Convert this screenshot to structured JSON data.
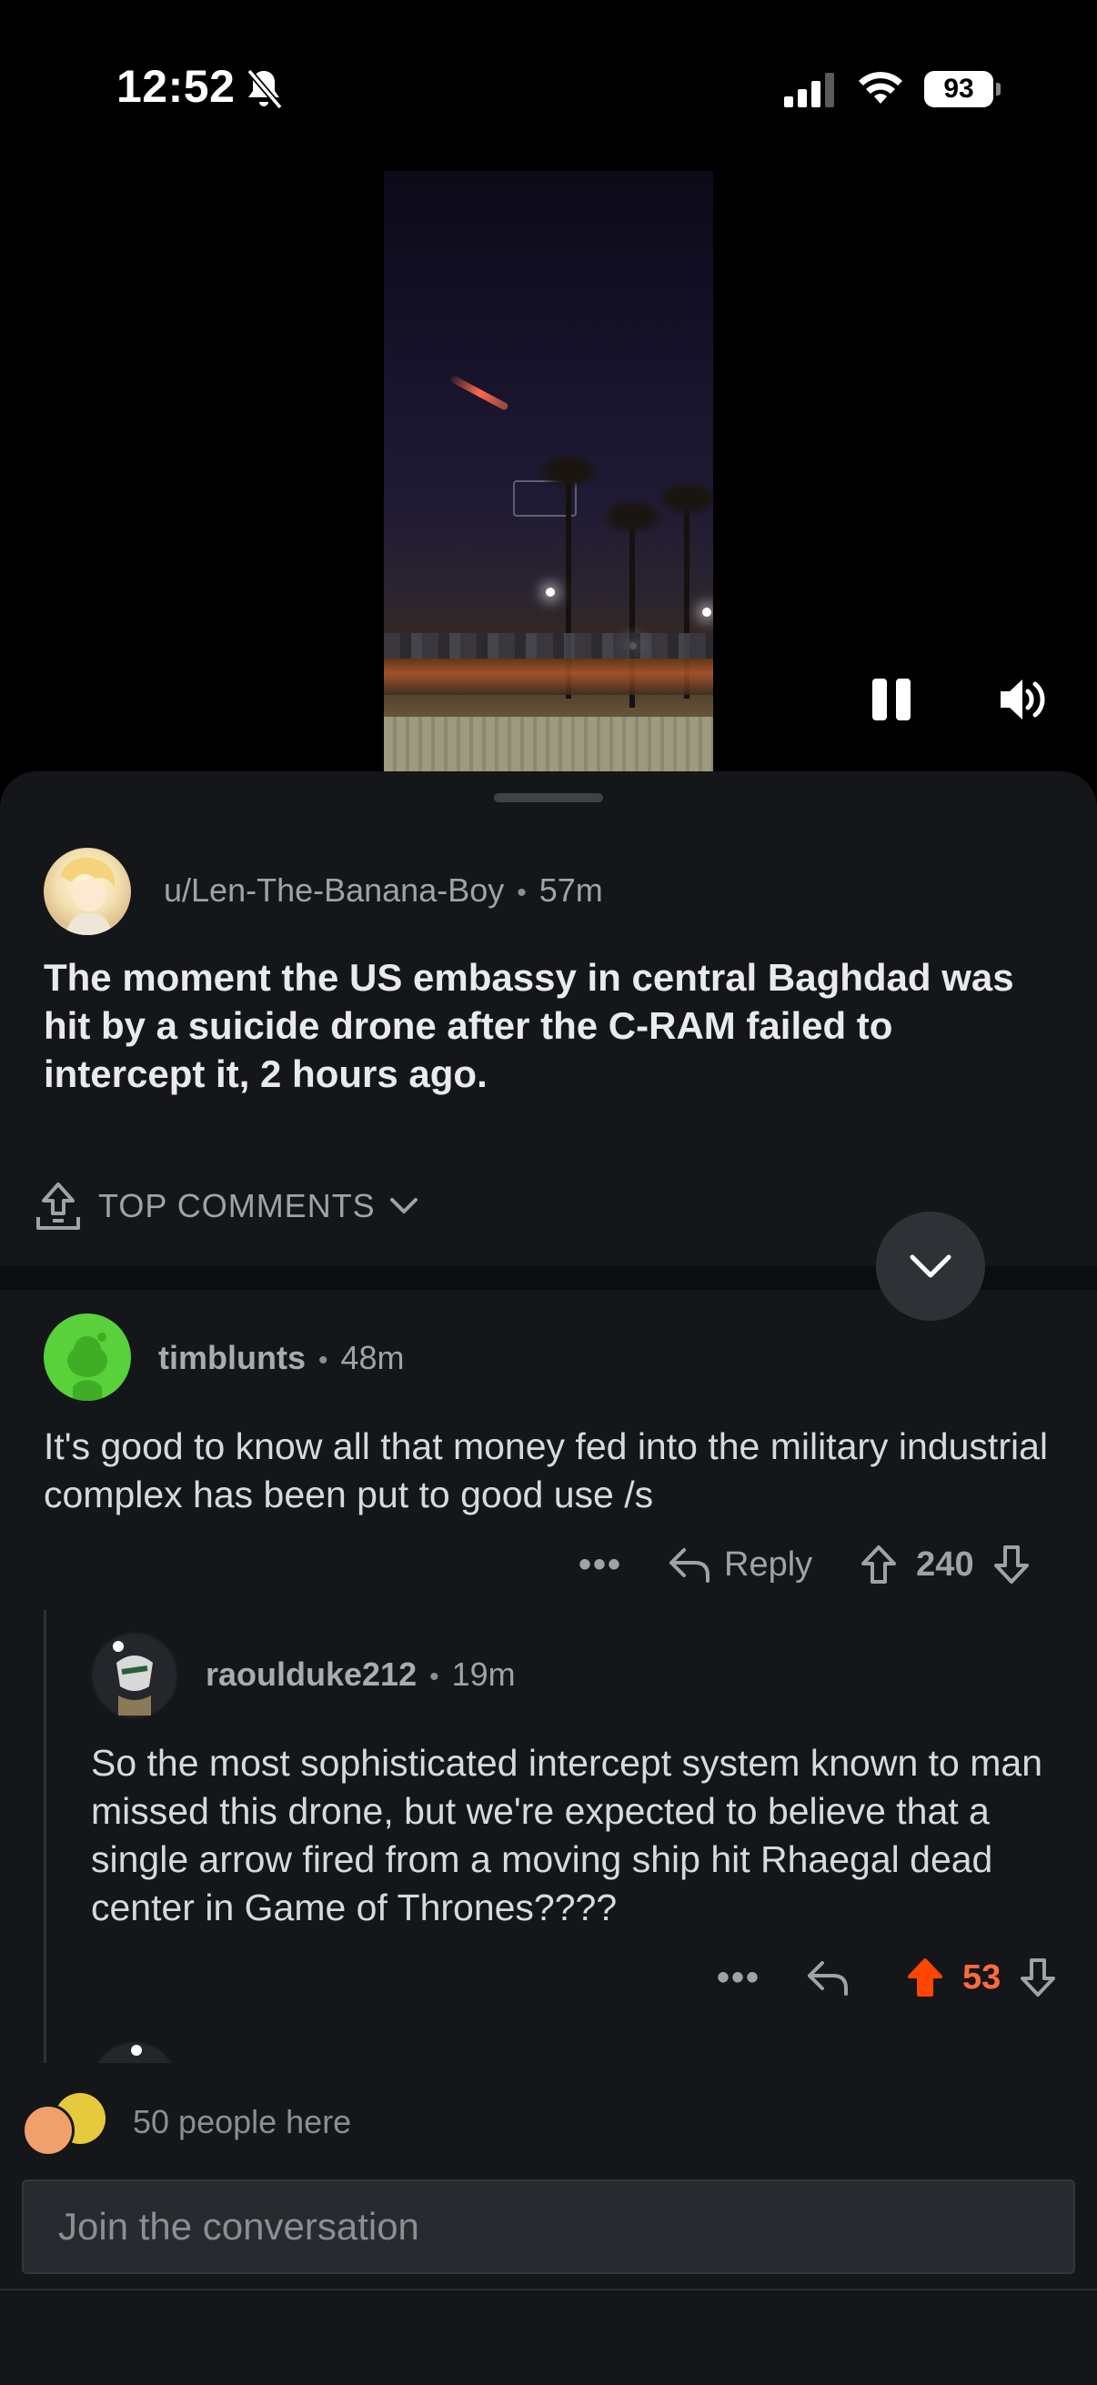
{
  "status_bar": {
    "time": "12:52",
    "battery": "93",
    "icons": [
      "bell-slash-icon",
      "cellular-signal-icon",
      "wifi-icon",
      "battery-icon"
    ]
  },
  "video": {
    "controls": [
      "pause-icon",
      "volume-icon"
    ]
  },
  "post": {
    "author": "u/Len-The-Banana-Boy",
    "separator": "•",
    "age": "57m",
    "title": "The moment the US embassy in central Baghdad was hit by a suicide drone after the C-RAM failed to intercept it, 2 hours ago."
  },
  "comments_header": {
    "sort_label": "TOP COMMENTS",
    "icons": [
      "award-icon",
      "chevron-down-icon"
    ]
  },
  "comments": [
    {
      "author": "timblunts",
      "age": "48m",
      "body": "It's good to know all that money fed into the military industrial complex has been put to good use /s",
      "reply_label": "Reply",
      "score": "240",
      "more": "•••"
    },
    {
      "author": "raoulduke212",
      "age": "19m",
      "body": "So the most sophisticated intercept system known to man missed this drone, but we're expected to believe that a single arrow fired from a moving ship hit Rhaegal dead center in Game of Thrones????",
      "score": "53",
      "more": "•••",
      "upvoted": true
    }
  ],
  "presence": {
    "text": "50 people here"
  },
  "composer": {
    "placeholder": "Join the conversation"
  },
  "colors": {
    "sheet_background": "#141619",
    "upvote_active": "#ff4500",
    "score_active": "#ff6a3d",
    "secondary_text": "#9ea3a8"
  }
}
